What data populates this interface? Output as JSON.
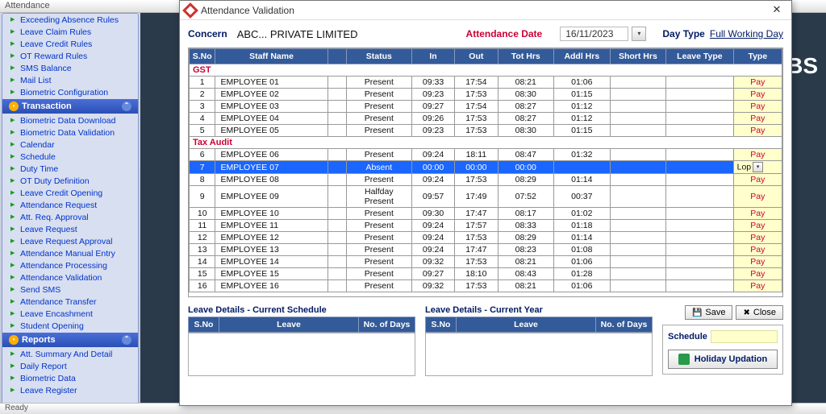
{
  "app_title": "Attendance",
  "statusbar": "Ready",
  "sidebar": {
    "top_items": [
      "Exceeding Absence Rules",
      "Leave Claim  Rules",
      "Leave Credit Rules",
      "OT Reward Rules",
      "SMS Balance",
      "Mail List",
      "Biometric Configuration"
    ],
    "groups": [
      {
        "label": "Transaction",
        "items": [
          "Biometric Data Download",
          "Biometric Data Validation",
          "Calendar",
          "Schedule",
          "Duty Time",
          "OT Duty Definition",
          "Leave Credit Opening",
          "Attendance Request",
          "Att. Req. Approval",
          "Leave Request",
          "Leave Request Approval",
          "Attendance Manual Entry",
          "Attendance Processing",
          "Attendance Validation",
          "Send SMS",
          "Attendance Transfer",
          "Leave Encashment",
          "Student Opening"
        ]
      },
      {
        "label": "Reports",
        "items": [
          "Att. Summary And Detail",
          "Daily Report",
          "Biometric Data",
          "Leave Register"
        ]
      }
    ]
  },
  "dialog": {
    "title": "Attendance Validation",
    "concern_label": "Concern",
    "concern_value": "ABC... PRIVATE LIMITED",
    "attendance_date_label": "Attendance Date",
    "attendance_date": "16/11/2023",
    "day_type_label": "Day Type",
    "day_type_value": "Full Working Day",
    "columns": [
      "S.No",
      "Staff Name",
      "",
      "Status",
      "In",
      "Out",
      "Tot Hrs",
      "Addl Hrs",
      "Short Hrs",
      "Leave Type",
      "Type"
    ],
    "groups": [
      {
        "name": "GST",
        "rows": [
          {
            "n": "1",
            "name": "EMPLOYEE 01",
            "status": "Present",
            "in": "09:33",
            "out": "17:54",
            "tot": "08:21",
            "addl": "01:06",
            "short": "",
            "leave": "",
            "type": "Pay"
          },
          {
            "n": "2",
            "name": "EMPLOYEE 02",
            "status": "Present",
            "in": "09:23",
            "out": "17:53",
            "tot": "08:30",
            "addl": "01:15",
            "short": "",
            "leave": "",
            "type": "Pay"
          },
          {
            "n": "3",
            "name": "EMPLOYEE 03",
            "status": "Present",
            "in": "09:27",
            "out": "17:54",
            "tot": "08:27",
            "addl": "01:12",
            "short": "",
            "leave": "",
            "type": "Pay"
          },
          {
            "n": "4",
            "name": "EMPLOYEE 04",
            "status": "Present",
            "in": "09:26",
            "out": "17:53",
            "tot": "08:27",
            "addl": "01:12",
            "short": "",
            "leave": "",
            "type": "Pay"
          },
          {
            "n": "5",
            "name": "EMPLOYEE 05",
            "status": "Present",
            "in": "09:23",
            "out": "17:53",
            "tot": "08:30",
            "addl": "01:15",
            "short": "",
            "leave": "",
            "type": "Pay"
          }
        ]
      },
      {
        "name": "Tax Audit",
        "rows": [
          {
            "n": "6",
            "name": "EMPLOYEE 06",
            "status": "Present",
            "in": "09:24",
            "out": "18:11",
            "tot": "08:47",
            "addl": "01:32",
            "short": "",
            "leave": "",
            "type": "Pay"
          },
          {
            "n": "7",
            "name": "EMPLOYEE 07",
            "status": "Absent",
            "in": "00:00",
            "out": "00:00",
            "tot": "00:00",
            "addl": "",
            "short": "",
            "leave": "",
            "type": "Lop",
            "selected": true
          },
          {
            "n": "8",
            "name": "EMPLOYEE 08",
            "status": "Present",
            "in": "09:24",
            "out": "17:53",
            "tot": "08:29",
            "addl": "01:14",
            "short": "",
            "leave": "",
            "type": "Pay"
          },
          {
            "n": "9",
            "name": "EMPLOYEE 09",
            "status": "Halfday Present",
            "in": "09:57",
            "out": "17:49",
            "tot": "07:52",
            "addl": "00:37",
            "short": "",
            "leave": "",
            "type": "Pay"
          },
          {
            "n": "10",
            "name": "EMPLOYEE 10",
            "status": "Present",
            "in": "09:30",
            "out": "17:47",
            "tot": "08:17",
            "addl": "01:02",
            "short": "",
            "leave": "",
            "type": "Pay"
          },
          {
            "n": "11",
            "name": "EMPLOYEE 11",
            "status": "Present",
            "in": "09:24",
            "out": "17:57",
            "tot": "08:33",
            "addl": "01:18",
            "short": "",
            "leave": "",
            "type": "Pay"
          },
          {
            "n": "12",
            "name": "EMPLOYEE 12",
            "status": "Present",
            "in": "09:24",
            "out": "17:53",
            "tot": "08:29",
            "addl": "01:14",
            "short": "",
            "leave": "",
            "type": "Pay"
          },
          {
            "n": "13",
            "name": "EMPLOYEE 13",
            "status": "Present",
            "in": "09:24",
            "out": "17:47",
            "tot": "08:23",
            "addl": "01:08",
            "short": "",
            "leave": "",
            "type": "Pay"
          },
          {
            "n": "14",
            "name": "EMPLOYEE 14",
            "status": "Present",
            "in": "09:32",
            "out": "17:53",
            "tot": "08:21",
            "addl": "01:06",
            "short": "",
            "leave": "",
            "type": "Pay"
          },
          {
            "n": "15",
            "name": "EMPLOYEE 15",
            "status": "Present",
            "in": "09:27",
            "out": "18:10",
            "tot": "08:43",
            "addl": "01:28",
            "short": "",
            "leave": "",
            "type": "Pay"
          },
          {
            "n": "16",
            "name": "EMPLOYEE 16",
            "status": "Present",
            "in": "09:32",
            "out": "17:53",
            "tot": "08:21",
            "addl": "01:06",
            "short": "",
            "leave": "",
            "type": "Pay"
          }
        ]
      }
    ],
    "leave_schedule_title": "Leave Details - Current Schedule",
    "leave_year_title": "Leave Details - Current Year",
    "leave_cols": [
      "S.No",
      "Leave",
      "No. of Days"
    ],
    "save_label": "Save",
    "close_label": "Close",
    "schedule_label": "Schedule",
    "holiday_btn": "Holiday Updation"
  }
}
